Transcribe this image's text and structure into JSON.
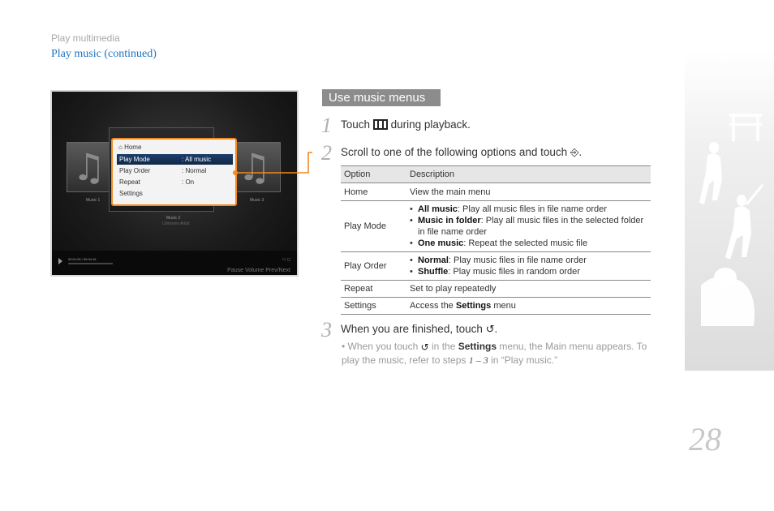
{
  "breadcrumb": {
    "section": "Play multimedia",
    "page": "Play music  (continued)"
  },
  "screenshot": {
    "menu_title": "Home",
    "menu_rows": [
      {
        "key": "Play Mode",
        "value": ": All music",
        "selected": true
      },
      {
        "key": "Play Order",
        "value": ": Normal",
        "selected": false
      },
      {
        "key": "Repeat",
        "value": ": On",
        "selected": false
      },
      {
        "key": "Settings",
        "value": "",
        "selected": false
      }
    ],
    "tile_left_label": "Music 1",
    "tile_right_label": "Music 3",
    "center_label": "Music 2",
    "center_sub": "Unknown Artist",
    "time": "00:01:05 / 00:04:16",
    "controls": "Pause   Volume   Prev/Next"
  },
  "section_title": "Use music menus",
  "steps": [
    {
      "num": "1",
      "before": "Touch",
      "icon": "menu-bars-icon",
      "after": "during playback."
    },
    {
      "num": "2",
      "before": "Scroll to one of the following options and touch",
      "icon": "enter-icon",
      "after": "."
    },
    {
      "num": "3",
      "before": "When you are finished, touch",
      "icon": "back-icon",
      "after": "."
    }
  ],
  "table": {
    "headers": [
      "Option",
      "Description"
    ],
    "rows": [
      {
        "option": "Home",
        "desc": "View the main menu"
      },
      {
        "option": "Play Mode",
        "items": [
          {
            "bold": "All music",
            "rest": ": Play all music files in file name order"
          },
          {
            "bold": "Music in folder",
            "rest": ": Play all music files in the selected folder in file name order"
          },
          {
            "bold": "One music",
            "rest": ": Repeat the selected music file"
          }
        ]
      },
      {
        "option": "Play Order",
        "items": [
          {
            "bold": "Normal",
            "rest": ": Play music files in file name order"
          },
          {
            "bold": "Shuffle",
            "rest": ": Play music files in random order"
          }
        ]
      },
      {
        "option": "Repeat",
        "desc": "Set to play repeatedly"
      },
      {
        "option": "Settings",
        "desc_pre": "Access the ",
        "desc_bold": "Settings",
        "desc_post": " menu"
      }
    ]
  },
  "note": {
    "pre": "When you touch",
    "mid": "in the",
    "bold": "Settings",
    "post": "menu, the Main menu appears. To play the music, refer to steps",
    "steps_ref": "1 – 3",
    "end": "in “Play music.”"
  },
  "page_number": "28",
  "colors": {
    "accent_orange": "#f28a1e",
    "link_blue": "#1a73c2",
    "title_gray": "#8c8c8c"
  }
}
